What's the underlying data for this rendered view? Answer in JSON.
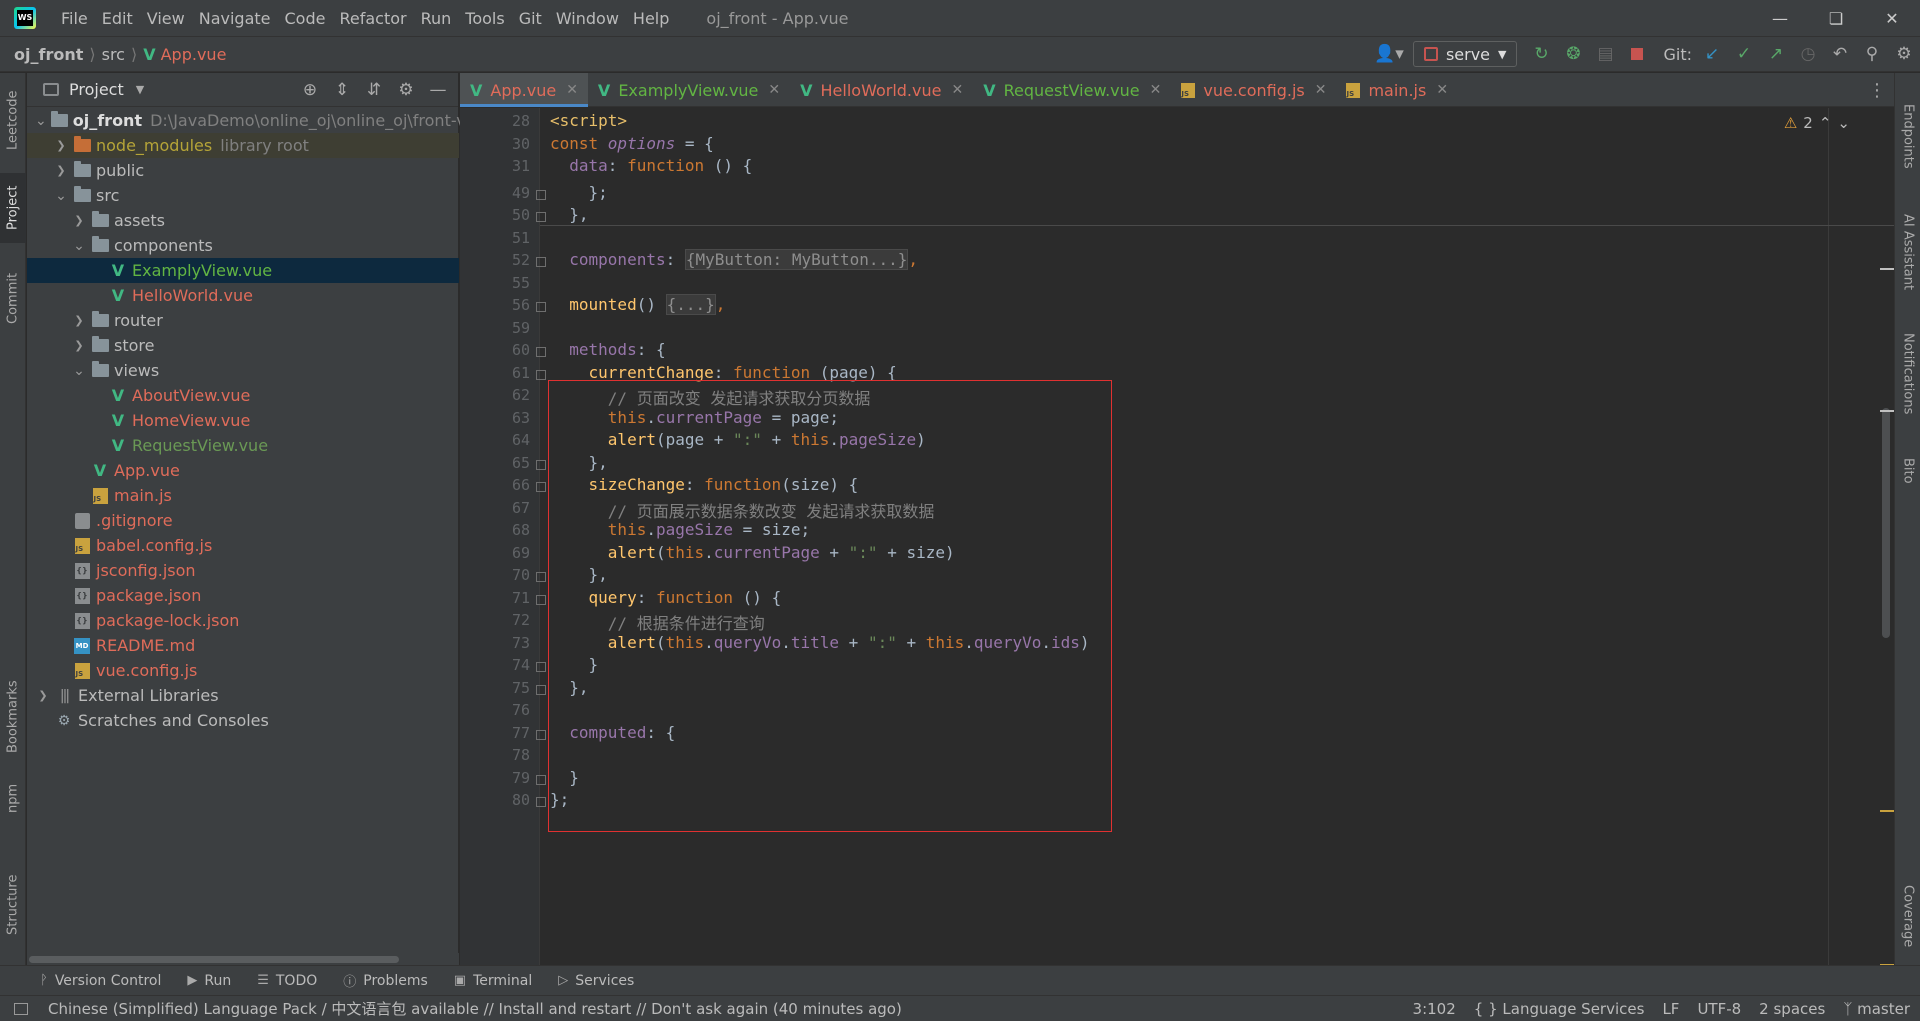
{
  "menu": [
    "File",
    "Edit",
    "View",
    "Navigate",
    "Code",
    "Refactor",
    "Run",
    "Tools",
    "Git",
    "Window",
    "Help"
  ],
  "window_title": "oj_front - App.vue",
  "breadcrumb": {
    "project": "oj_front",
    "folder": "src",
    "file": "App.vue"
  },
  "run_config": "serve",
  "git_label": "Git:",
  "left_tabs": [
    "Leetcode",
    "Project",
    "Commit",
    "Bookmarks",
    "npm",
    "Structure"
  ],
  "right_tabs": [
    "Endpoints",
    "AI Assistant",
    "Notifications",
    "Bito",
    "Coverage"
  ],
  "project_panel": {
    "title": "Project",
    "tree": [
      {
        "label": "oj_front",
        "hint": "D:\\JavaDemo\\online_oj\\online_oj\\front-vue",
        "icon": "folder",
        "depth": 0,
        "arrow": "open",
        "style": "bold"
      },
      {
        "label": "node_modules",
        "hint": "library root",
        "icon": "folder-orange",
        "depth": 1,
        "arrow": "closed",
        "style": "olive",
        "row": "library"
      },
      {
        "label": "public",
        "icon": "folder",
        "depth": 1,
        "arrow": "closed",
        "style": "white"
      },
      {
        "label": "src",
        "icon": "folder",
        "depth": 1,
        "arrow": "open",
        "style": "white"
      },
      {
        "label": "assets",
        "icon": "folder",
        "depth": 2,
        "arrow": "closed",
        "style": "white"
      },
      {
        "label": "components",
        "icon": "folder",
        "depth": 2,
        "arrow": "open",
        "style": "white"
      },
      {
        "label": "ExamplyView.vue",
        "icon": "vue",
        "depth": 3,
        "arrow": "none",
        "style": "green",
        "row": "selected"
      },
      {
        "label": "HelloWorld.vue",
        "icon": "vue",
        "depth": 3,
        "arrow": "none",
        "style": "red"
      },
      {
        "label": "router",
        "icon": "folder",
        "depth": 2,
        "arrow": "closed",
        "style": "white"
      },
      {
        "label": "store",
        "icon": "folder",
        "depth": 2,
        "arrow": "closed",
        "style": "white"
      },
      {
        "label": "views",
        "icon": "folder",
        "depth": 2,
        "arrow": "open",
        "style": "white"
      },
      {
        "label": "AboutView.vue",
        "icon": "vue",
        "depth": 3,
        "arrow": "none",
        "style": "red"
      },
      {
        "label": "HomeView.vue",
        "icon": "vue",
        "depth": 3,
        "arrow": "none",
        "style": "red"
      },
      {
        "label": "RequestView.vue",
        "icon": "vue",
        "depth": 3,
        "arrow": "none",
        "style": "green2"
      },
      {
        "label": "App.vue",
        "icon": "vue",
        "depth": 2,
        "arrow": "none",
        "style": "red"
      },
      {
        "label": "main.js",
        "icon": "js",
        "depth": 2,
        "arrow": "none",
        "style": "red"
      },
      {
        "label": ".gitignore",
        "icon": "git",
        "depth": 1,
        "arrow": "none",
        "style": "red"
      },
      {
        "label": "babel.config.js",
        "icon": "js",
        "depth": 1,
        "arrow": "none",
        "style": "red"
      },
      {
        "label": "jsconfig.json",
        "icon": "json",
        "depth": 1,
        "arrow": "none",
        "style": "red"
      },
      {
        "label": "package.json",
        "icon": "json",
        "depth": 1,
        "arrow": "none",
        "style": "red"
      },
      {
        "label": "package-lock.json",
        "icon": "json",
        "depth": 1,
        "arrow": "none",
        "style": "red"
      },
      {
        "label": "README.md",
        "icon": "md",
        "depth": 1,
        "arrow": "none",
        "style": "red"
      },
      {
        "label": "vue.config.js",
        "icon": "js",
        "depth": 1,
        "arrow": "none",
        "style": "red"
      },
      {
        "label": "External Libraries",
        "icon": "lib",
        "depth": 0,
        "arrow": "closed",
        "style": "white"
      },
      {
        "label": "Scratches and Consoles",
        "icon": "scratch",
        "depth": 0,
        "arrow": "none",
        "style": "white"
      }
    ]
  },
  "tabs": [
    {
      "label": "App.vue",
      "icon": "vue",
      "color": "#e06c5a",
      "active": true
    },
    {
      "label": "ExamplyView.vue",
      "icon": "vue",
      "color": "#62b543",
      "active": false
    },
    {
      "label": "HelloWorld.vue",
      "icon": "vue",
      "color": "#e06c5a",
      "active": false
    },
    {
      "label": "RequestView.vue",
      "icon": "vue",
      "color": "#62b543",
      "active": false
    },
    {
      "label": "vue.config.js",
      "icon": "js",
      "color": "#e06c5a",
      "active": false
    },
    {
      "label": "main.js",
      "icon": "js",
      "color": "#e06c5a",
      "active": false
    }
  ],
  "warnings": "2",
  "line_numbers": [
    "28",
    "30",
    "31",
    "49",
    "50",
    "51",
    "52",
    "55",
    "56",
    "59",
    "60",
    "61",
    "62",
    "63",
    "64",
    "65",
    "66",
    "67",
    "68",
    "69",
    "70",
    "71",
    "72",
    "73",
    "74",
    "75",
    "76",
    "77",
    "78",
    "79",
    "80"
  ],
  "code": [
    [
      [
        "tag",
        "<script>"
      ]
    ],
    [
      [
        "kw",
        "const "
      ],
      [
        "propi",
        "options"
      ],
      [
        "plain",
        " = {"
      ]
    ],
    [
      [
        "plain",
        "  "
      ],
      [
        "prop",
        "data"
      ],
      [
        "plain",
        ": "
      ],
      [
        "kw",
        "function "
      ],
      [
        "plain",
        "() {"
      ]
    ],
    [
      [
        "plain",
        "    };"
      ]
    ],
    [
      [
        "plain",
        "  },"
      ]
    ],
    [],
    [
      [
        "plain",
        "  "
      ],
      [
        "prop",
        "components"
      ],
      [
        "plain",
        ": "
      ],
      [
        "folded",
        "{MyButton: MyButton...}"
      ],
      [
        "kw",
        ","
      ]
    ],
    [],
    [
      [
        "plain",
        "  "
      ],
      [
        "fn",
        "mounted"
      ],
      [
        "plain",
        "() "
      ],
      [
        "folded",
        "{...}"
      ],
      [
        "kw",
        ","
      ]
    ],
    [],
    [
      [
        "plain",
        "  "
      ],
      [
        "prop",
        "methods"
      ],
      [
        "plain",
        ": {"
      ]
    ],
    [
      [
        "plain",
        "    "
      ],
      [
        "fn",
        "currentChange"
      ],
      [
        "plain",
        ": "
      ],
      [
        "kw",
        "function "
      ],
      [
        "plain",
        "(page) {"
      ]
    ],
    [
      [
        "cmt",
        "      // 页面改变 发起请求获取分页数据"
      ]
    ],
    [
      [
        "plain",
        "      "
      ],
      [
        "kw",
        "this"
      ],
      [
        "plain",
        "."
      ],
      [
        "prop",
        "currentPage"
      ],
      [
        "plain",
        " = page;"
      ]
    ],
    [
      [
        "plain",
        "      "
      ],
      [
        "fn",
        "alert"
      ],
      [
        "plain",
        "(page + "
      ],
      [
        "str",
        "\":\""
      ],
      [
        "plain",
        " + "
      ],
      [
        "kw",
        "this"
      ],
      [
        "plain",
        "."
      ],
      [
        "prop",
        "pageSize"
      ],
      [
        "plain",
        ")"
      ]
    ],
    [
      [
        "plain",
        "    },"
      ]
    ],
    [
      [
        "plain",
        "    "
      ],
      [
        "fn",
        "sizeChange"
      ],
      [
        "plain",
        ": "
      ],
      [
        "kw",
        "function"
      ],
      [
        "plain",
        "(size) {"
      ]
    ],
    [
      [
        "cmt",
        "      // 页面展示数据条数改变 发起请求获取数据"
      ]
    ],
    [
      [
        "plain",
        "      "
      ],
      [
        "kw",
        "this"
      ],
      [
        "plain",
        "."
      ],
      [
        "prop",
        "pageSize"
      ],
      [
        "plain",
        " = size;"
      ]
    ],
    [
      [
        "plain",
        "      "
      ],
      [
        "fn",
        "alert"
      ],
      [
        "plain",
        "("
      ],
      [
        "kw",
        "this"
      ],
      [
        "plain",
        "."
      ],
      [
        "prop",
        "currentPage"
      ],
      [
        "plain",
        " + "
      ],
      [
        "str",
        "\":\""
      ],
      [
        "plain",
        " + size)"
      ]
    ],
    [
      [
        "plain",
        "    },"
      ]
    ],
    [
      [
        "plain",
        "    "
      ],
      [
        "fn",
        "query"
      ],
      [
        "plain",
        ": "
      ],
      [
        "kw",
        "function "
      ],
      [
        "plain",
        "() {"
      ]
    ],
    [
      [
        "cmt",
        "      // 根据条件进行查询"
      ]
    ],
    [
      [
        "plain",
        "      "
      ],
      [
        "fn",
        "alert"
      ],
      [
        "plain",
        "("
      ],
      [
        "kw",
        "this"
      ],
      [
        "plain",
        "."
      ],
      [
        "prop",
        "queryVo"
      ],
      [
        "plain",
        "."
      ],
      [
        "prop",
        "title"
      ],
      [
        "plain",
        " + "
      ],
      [
        "str",
        "\":\""
      ],
      [
        "plain",
        " + "
      ],
      [
        "kw",
        "this"
      ],
      [
        "plain",
        "."
      ],
      [
        "prop",
        "queryVo"
      ],
      [
        "plain",
        "."
      ],
      [
        "prop",
        "ids"
      ],
      [
        "plain",
        ")"
      ]
    ],
    [
      [
        "plain",
        "    }"
      ]
    ],
    [
      [
        "plain",
        "  },"
      ]
    ],
    [],
    [
      [
        "plain",
        "  "
      ],
      [
        "prop",
        "computed"
      ],
      [
        "plain",
        ": {"
      ]
    ],
    [],
    [
      [
        "plain",
        "  }"
      ]
    ],
    [
      [
        "plain",
        "};"
      ]
    ]
  ],
  "bottom_tabs": [
    {
      "label": "Version Control",
      "icon": "branch-icon"
    },
    {
      "label": "Run",
      "icon": "play-icon"
    },
    {
      "label": "TODO",
      "icon": "list-icon"
    },
    {
      "label": "Problems",
      "icon": "info-icon"
    },
    {
      "label": "Terminal",
      "icon": "terminal-icon"
    },
    {
      "label": "Services",
      "icon": "services-icon"
    }
  ],
  "status": {
    "message": "Chinese (Simplified) Language Pack / 中文语言包 available // Install and restart // Don't ask again (40 minutes ago)",
    "position": "3:102",
    "language_services": "Language Services",
    "line_sep": "LF",
    "encoding": "UTF-8",
    "indent": "2 spaces",
    "branch": "master"
  },
  "colors": {
    "accent": "#4a88c7",
    "highlight_box": "#e03131",
    "vue_green": "#41b883",
    "modified_red": "#e06c5a"
  }
}
